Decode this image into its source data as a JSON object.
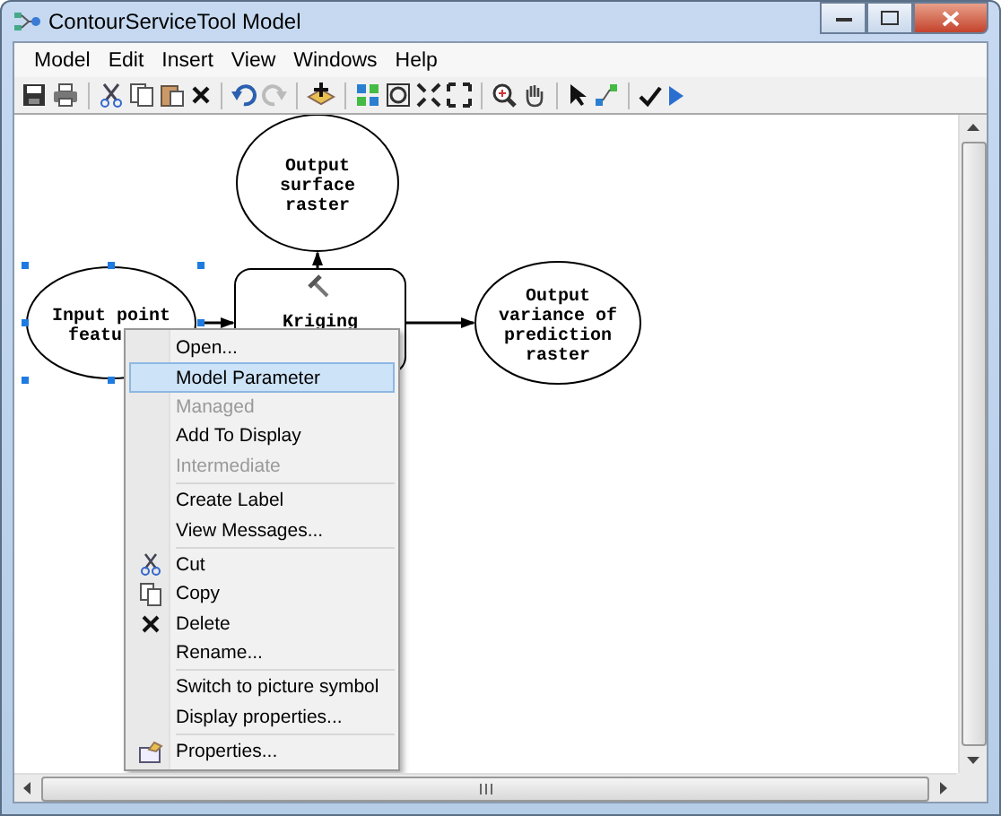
{
  "window": {
    "title": "ContourServiceTool Model"
  },
  "menu_bar": [
    "Model",
    "Edit",
    "Insert",
    "View",
    "Windows",
    "Help"
  ],
  "diagram": {
    "nodes": [
      {
        "kind": "data",
        "lines": [
          "Output",
          "surface",
          "raster"
        ],
        "selected": false
      },
      {
        "kind": "data",
        "lines": [
          "Input point",
          "featu"
        ],
        "selected": true
      },
      {
        "kind": "tool",
        "lines": [
          "Kriging"
        ],
        "selected": false
      },
      {
        "kind": "data",
        "lines": [
          "Output",
          "variance of",
          "prediction",
          "raster"
        ],
        "selected": false
      }
    ]
  },
  "context_menu": {
    "groups": [
      [
        {
          "label": "Open...",
          "selected": false,
          "disabled": false
        },
        {
          "label": "Model Parameter",
          "selected": true,
          "disabled": false
        },
        {
          "label": "Managed",
          "selected": false,
          "disabled": true
        },
        {
          "label": "Add To Display",
          "selected": false,
          "disabled": false
        },
        {
          "label": "Intermediate",
          "selected": false,
          "disabled": true
        }
      ],
      [
        {
          "label": "Create Label",
          "selected": false,
          "disabled": false
        },
        {
          "label": "View Messages...",
          "selected": false,
          "disabled": false
        }
      ],
      [
        {
          "label": "Cut",
          "selected": false,
          "disabled": false
        },
        {
          "label": "Copy",
          "selected": false,
          "disabled": false
        },
        {
          "label": "Delete",
          "selected": false,
          "disabled": false
        },
        {
          "label": "Rename...",
          "selected": false,
          "disabled": false
        }
      ],
      [
        {
          "label": "Switch to picture symbol",
          "selected": false,
          "disabled": false
        },
        {
          "label": "Display properties...",
          "selected": false,
          "disabled": false
        }
      ],
      [
        {
          "label": "Properties...",
          "selected": false,
          "disabled": false
        }
      ]
    ]
  }
}
